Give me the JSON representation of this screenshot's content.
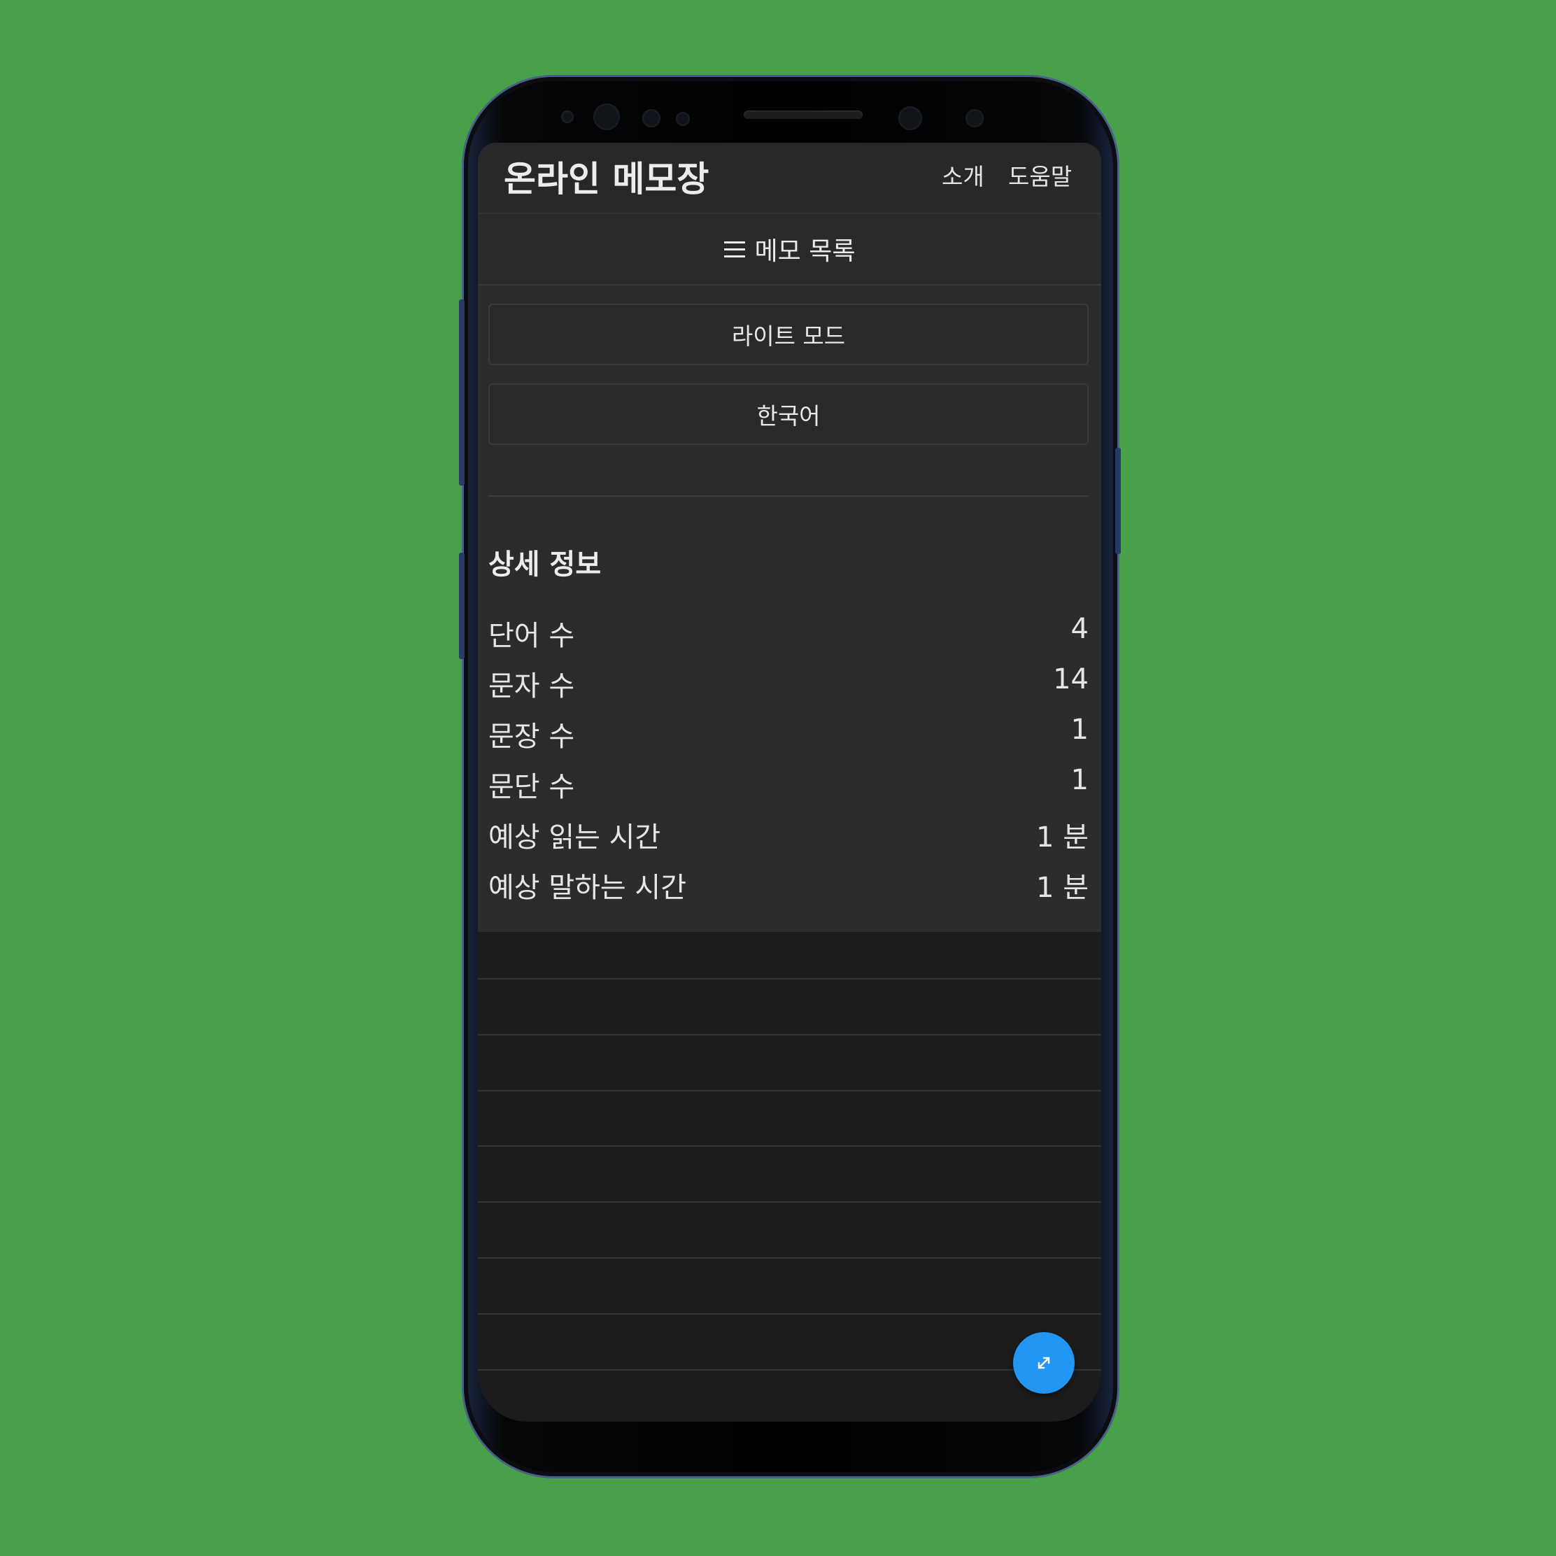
{
  "app": {
    "title": "온라인 메모장",
    "nav": {
      "about": "소개",
      "help": "도움말"
    }
  },
  "memo_list": {
    "label": "메모 목록",
    "icon": "hamburger-menu-icon"
  },
  "settings": {
    "theme_button": "라이트 모드",
    "language_button": "한국어"
  },
  "details": {
    "title": "상세 정보",
    "stats": [
      {
        "label": "단어 수",
        "value": "4"
      },
      {
        "label": "문자 수",
        "value": "14"
      },
      {
        "label": "문장 수",
        "value": "1"
      },
      {
        "label": "문단 수",
        "value": "1"
      },
      {
        "label": "예상 읽는 시간",
        "value": "1 분"
      },
      {
        "label": "예상 말하는 시간",
        "value": "1 분"
      }
    ]
  },
  "fab": {
    "icon": "expand-arrows-icon"
  },
  "colors": {
    "background": "#49a04a",
    "surface": "#2c2c2c",
    "editor": "#1c1c1c",
    "accent": "#2196f3",
    "text": "#e6e6e6"
  }
}
